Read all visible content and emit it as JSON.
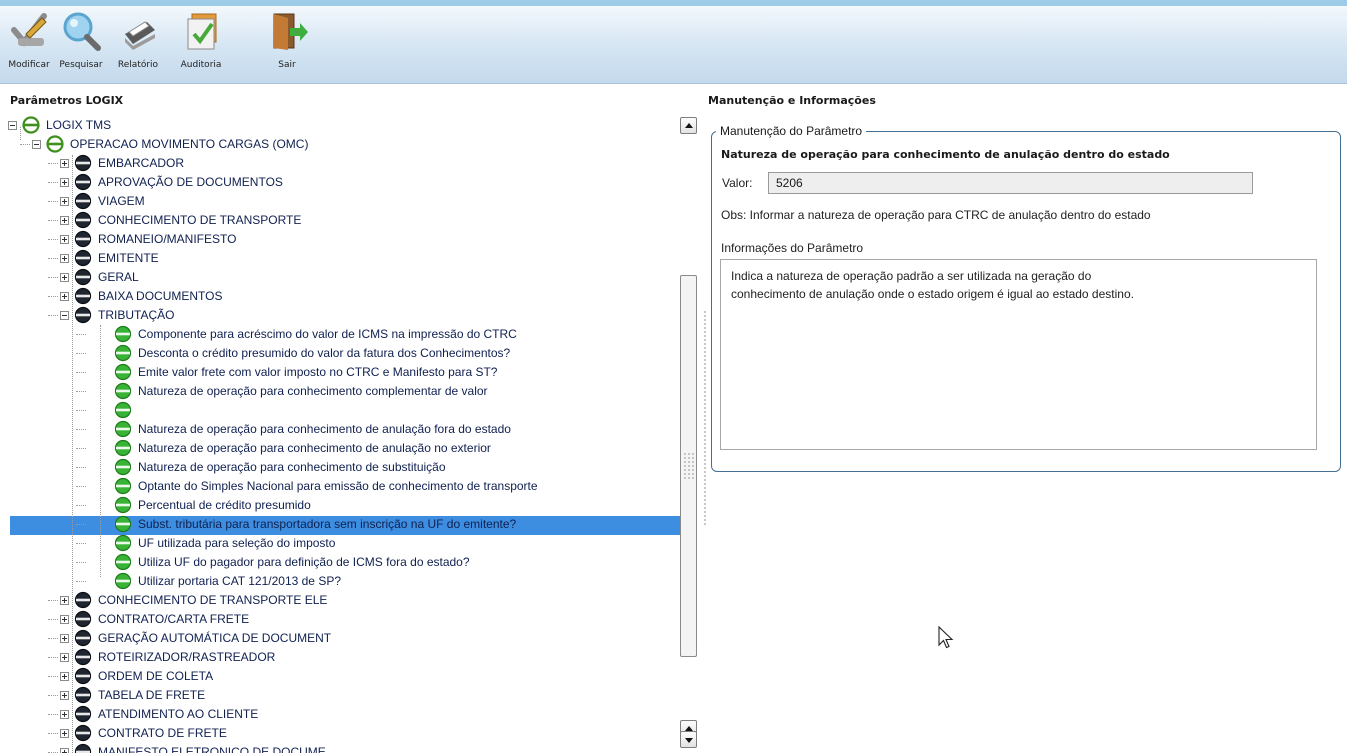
{
  "toolbar": {
    "buttons": [
      {
        "label": "Modificar",
        "icon": "pencil-check-icon"
      },
      {
        "label": "Pesquisar",
        "icon": "magnifier-icon"
      },
      {
        "label": "Relatório",
        "icon": "printer-icon"
      },
      {
        "label": "Auditoria",
        "icon": "clipboard-check-icon"
      },
      {
        "label": "Sair",
        "icon": "exit-door-icon"
      }
    ]
  },
  "left_panel": {
    "title": "Parâmetros LOGIX",
    "tree": [
      {
        "label": "LOGIX TMS",
        "level": 0,
        "expander": "minus",
        "icon": "white"
      },
      {
        "label": "OPERACAO MOVIMENTO CARGAS (OMC)",
        "level": 1,
        "expander": "minus",
        "icon": "white"
      },
      {
        "label": "EMBARCADOR",
        "level": 2,
        "expander": "plus",
        "icon": "dark"
      },
      {
        "label": "APROVAÇÃO DE DOCUMENTOS",
        "level": 2,
        "expander": "plus",
        "icon": "dark"
      },
      {
        "label": "VIAGEM",
        "level": 2,
        "expander": "plus",
        "icon": "dark"
      },
      {
        "label": "CONHECIMENTO DE TRANSPORTE",
        "level": 2,
        "expander": "plus",
        "icon": "dark"
      },
      {
        "label": "ROMANEIO/MANIFESTO",
        "level": 2,
        "expander": "plus",
        "icon": "dark"
      },
      {
        "label": "EMITENTE",
        "level": 2,
        "expander": "plus",
        "icon": "dark"
      },
      {
        "label": "GERAL",
        "level": 2,
        "expander": "plus",
        "icon": "dark"
      },
      {
        "label": "BAIXA DOCUMENTOS",
        "level": 2,
        "expander": "plus",
        "icon": "dark"
      },
      {
        "label": "TRIBUTAÇÃO",
        "level": 2,
        "expander": "minus",
        "icon": "dark"
      },
      {
        "label": "Componente para acréscimo do valor de ICMS na impressão do CTRC",
        "level": 3,
        "icon": "green"
      },
      {
        "label": "Desconta o crédito presumido do valor da fatura dos Conhecimentos?",
        "level": 3,
        "icon": "green"
      },
      {
        "label": "Emite valor frete com valor imposto no CTRC e Manifesto para ST?",
        "level": 3,
        "icon": "green"
      },
      {
        "label": "Natureza de operação para conhecimento complementar de valor",
        "level": 3,
        "icon": "green"
      },
      {
        "label": "Natureza de operação para conhecimento de anulação dentro do estado",
        "level": 3,
        "icon": "green",
        "selected": true
      },
      {
        "label": "Natureza de operação para conhecimento de anulação fora do estado",
        "level": 3,
        "icon": "green"
      },
      {
        "label": "Natureza de operação para conhecimento de anulação no exterior",
        "level": 3,
        "icon": "green"
      },
      {
        "label": "Natureza de operação para conhecimento de substituição",
        "level": 3,
        "icon": "green"
      },
      {
        "label": "Optante do Simples Nacional para emissão de conhecimento de transporte",
        "level": 3,
        "icon": "green"
      },
      {
        "label": "Percentual de crédito presumido",
        "level": 3,
        "icon": "green"
      },
      {
        "label": "Subst. tributária para transportadora sem inscrição na UF do emitente?",
        "level": 3,
        "icon": "green"
      },
      {
        "label": "UF utilizada para seleção do imposto",
        "level": 3,
        "icon": "green"
      },
      {
        "label": "Utiliza UF do pagador para definição de ICMS fora do estado?",
        "level": 3,
        "icon": "green"
      },
      {
        "label": "Utilizar portaria CAT 121/2013 de SP?",
        "level": 3,
        "icon": "green"
      },
      {
        "label": "CONHECIMENTO DE TRANSPORTE ELE",
        "level": 2,
        "expander": "plus",
        "icon": "dark"
      },
      {
        "label": "CONTRATO/CARTA FRETE",
        "level": 2,
        "expander": "plus",
        "icon": "dark"
      },
      {
        "label": "GERAÇÃO AUTOMÁTICA DE DOCUMENT",
        "level": 2,
        "expander": "plus",
        "icon": "dark"
      },
      {
        "label": "ROTEIRIZADOR/RASTREADOR",
        "level": 2,
        "expander": "plus",
        "icon": "dark"
      },
      {
        "label": "ORDEM DE COLETA",
        "level": 2,
        "expander": "plus",
        "icon": "dark"
      },
      {
        "label": "TABELA DE FRETE",
        "level": 2,
        "expander": "plus",
        "icon": "dark"
      },
      {
        "label": "ATENDIMENTO AO CLIENTE",
        "level": 2,
        "expander": "plus",
        "icon": "dark"
      },
      {
        "label": "CONTRATO DE FRETE",
        "level": 2,
        "expander": "plus",
        "icon": "dark"
      },
      {
        "label": "MANIFESTO ELETRONICO DE DOCUME",
        "level": 2,
        "expander": "plus",
        "icon": "dark"
      }
    ]
  },
  "right_panel": {
    "title": "Manutenção e Informações",
    "group_legend": "Manutenção do Parâmetro",
    "param_title": "Natureza de operação para conhecimento de anulação dentro do estado",
    "valor_label": "Valor:",
    "valor_value": "5206",
    "obs": "Obs: Informar a natureza de operação para CTRC de anulação dentro do estado",
    "info_label": "Informações do Parâmetro",
    "info_text": "Indica a natureza de operação padrão a ser utilizada na geração do\nconhecimento de anulação onde o estado origem é igual ao estado destino."
  },
  "colors": {
    "selection": "#3d8ee0",
    "group_border": "#466f96",
    "tree_text": "#102050"
  }
}
